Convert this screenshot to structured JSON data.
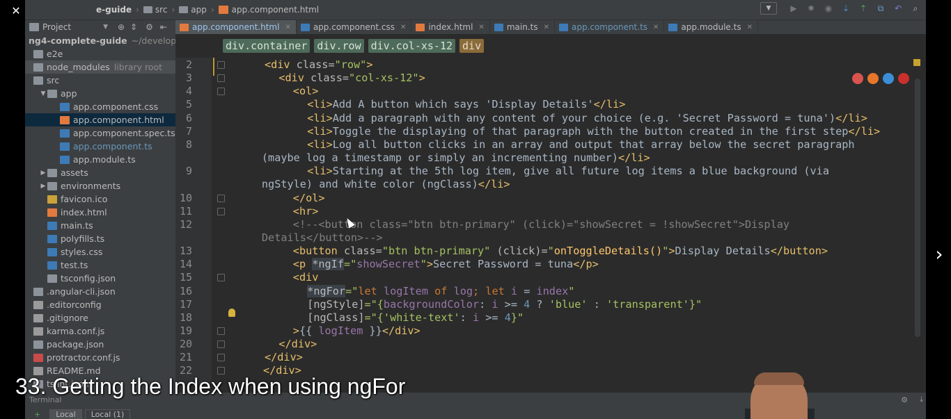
{
  "player": {
    "close_icon": "close-icon",
    "restore_icon": "restore-icon",
    "minimize_icon": "minimize-icon"
  },
  "navbar": {
    "crumbs": [
      "e-guide",
      "src",
      "app",
      "app.component.html"
    ]
  },
  "project_panel": {
    "label": "Project"
  },
  "tree": {
    "items": [
      {
        "label": "ng4-complete-guide",
        "extra": "~/developme",
        "type": "folder",
        "indent": 0
      },
      {
        "label": "e2e",
        "type": "folder",
        "indent": 0
      },
      {
        "label": "node_modules",
        "extra": "library root",
        "type": "folder",
        "indent": 0,
        "highlighted": true
      },
      {
        "label": "src",
        "type": "folder",
        "indent": 0
      },
      {
        "label": "app",
        "type": "folder",
        "indent": 1,
        "expanded": true
      },
      {
        "label": "app.component.css",
        "type": "css",
        "indent": 2
      },
      {
        "label": "app.component.html",
        "type": "html",
        "indent": 2,
        "selected": true
      },
      {
        "label": "app.component.spec.ts",
        "type": "ts",
        "indent": 2
      },
      {
        "label": "app.component.ts",
        "type": "ts",
        "indent": 2,
        "blue": true
      },
      {
        "label": "app.module.ts",
        "type": "ts",
        "indent": 2
      },
      {
        "label": "assets",
        "type": "folder",
        "indent": 1,
        "collapsed": true
      },
      {
        "label": "environments",
        "type": "folder",
        "indent": 1,
        "collapsed": true
      },
      {
        "label": "favicon.ico",
        "type": "ico",
        "indent": 1
      },
      {
        "label": "index.html",
        "type": "html",
        "indent": 1
      },
      {
        "label": "main.ts",
        "type": "ts",
        "indent": 1
      },
      {
        "label": "polyfills.ts",
        "type": "ts",
        "indent": 1
      },
      {
        "label": "styles.css",
        "type": "css",
        "indent": 1
      },
      {
        "label": "test.ts",
        "type": "ts",
        "indent": 1
      },
      {
        "label": "tsconfig.json",
        "type": "json",
        "indent": 1
      },
      {
        "label": ".angular-cli.json",
        "type": "json",
        "indent": 0
      },
      {
        "label": ".editorconfig",
        "type": "file",
        "indent": 0
      },
      {
        "label": ".gitignore",
        "type": "file",
        "indent": 0
      },
      {
        "label": "karma.conf.js",
        "type": "file",
        "indent": 0
      },
      {
        "label": "package.json",
        "type": "json",
        "indent": 0
      },
      {
        "label": "protractor.conf.js",
        "type": "red",
        "indent": 0
      },
      {
        "label": "README.md",
        "type": "file",
        "indent": 0
      },
      {
        "label": "tslint.json",
        "type": "json",
        "indent": 0
      }
    ]
  },
  "tabs": [
    {
      "label": "app.component.html",
      "icon": "html",
      "active": true
    },
    {
      "label": "app.component.css",
      "icon": "css"
    },
    {
      "label": "index.html",
      "icon": "html"
    },
    {
      "label": "main.ts",
      "icon": "ts"
    },
    {
      "label": "app.component.ts",
      "icon": "ts",
      "blue": true
    },
    {
      "label": "app.module.ts",
      "icon": "ts"
    }
  ],
  "breadcrumbs": [
    "div.container",
    "div.row",
    "div.col-xs-12",
    "div"
  ],
  "code_lines": [
    {
      "num": "2",
      "html": "<span class=\"t\">&lt;div</span> <span class=\"a\">class=</span><span class=\"s\">\"row\"</span><span class=\"t\">&gt;</span>",
      "indent": 0
    },
    {
      "num": "3",
      "html": "<span class=\"t\">&lt;div</span> <span class=\"a\">class=</span><span class=\"s\">\"col-xs-12\"</span><span class=\"t\">&gt;</span>",
      "indent": 1
    },
    {
      "num": "4",
      "html": "<span class=\"t\">&lt;ol&gt;</span>",
      "indent": 2
    },
    {
      "num": "5",
      "html": "<span class=\"t\">&lt;li&gt;</span>Add A button which says 'Display Details'<span class=\"t\">&lt;/li&gt;</span>",
      "indent": 3
    },
    {
      "num": "6",
      "html": "<span class=\"t\">&lt;li&gt;</span>Add a paragraph with any content of your choice (e.g. 'Secret Password = tuna')<span class=\"t\">&lt;/li&gt;</span>",
      "indent": 3
    },
    {
      "num": "7",
      "html": "<span class=\"t\">&lt;li&gt;</span>Toggle the displaying of that paragraph with the button created in the first step<span class=\"t\">&lt;/li&gt;</span>",
      "indent": 3
    },
    {
      "num": "8",
      "html": "<span class=\"t\">&lt;li&gt;</span>Log all button clicks in an array and output that array below the secret paragraph",
      "indent": 3
    },
    {
      "num": "",
      "html": "(maybe log a timestamp or simply an incrementing number)<span class=\"t\">&lt;/li&gt;</span>",
      "indent": -0.2
    },
    {
      "num": "9",
      "html": "<span class=\"t\">&lt;li&gt;</span>Starting at the 5th log item, give all future log items a blue background (via",
      "indent": 3
    },
    {
      "num": "",
      "html": "ngStyle) and white color (ngClass)<span class=\"t\">&lt;/li&gt;</span>",
      "indent": -0.2
    },
    {
      "num": "10",
      "html": "<span class=\"t\">&lt;/ol&gt;</span>",
      "indent": 2
    },
    {
      "num": "11",
      "html": "<span class=\"t\">&lt;hr&gt;</span>",
      "indent": 2
    },
    {
      "num": "12",
      "html": "<span class=\"c\">&lt;!--&lt;button class=\"btn btn-primary\" (click)=\"showSecret = !showSecret\"&gt;Display</span>",
      "indent": 2
    },
    {
      "num": "",
      "html": "<span class=\"c\">Details&lt;/button&gt;--&gt;</span>",
      "indent": -0.2
    },
    {
      "num": "13",
      "html": "<span class=\"t\">&lt;button</span> <span class=\"a\">class=</span><span class=\"s\">\"btn btn-primary\"</span> <span class=\"a\">(click)=</span><span class=\"s\">\"</span><span class=\"ang\">onToggleDetails()</span><span class=\"s\">\"</span><span class=\"t\">&gt;</span>Display Details<span class=\"t\">&lt;/button&gt;</span>",
      "indent": 2
    },
    {
      "num": "14",
      "html": "<span class=\"t\">&lt;p</span> <span class=\"a hlbg\">*ngIf</span><span class=\"s\">=\"</span><span class=\"ngx\">showSecret</span><span class=\"s\">\"</span><span class=\"t\">&gt;</span>Secret Password = tuna<span class=\"t\">&lt;/p&gt;</span>",
      "indent": 2
    },
    {
      "num": "15",
      "html": "<span class=\"t\">&lt;div</span>",
      "indent": 2
    },
    {
      "num": "16",
      "html": "<span class=\"a hlbg\">*ngFor</span><span class=\"s\">=\"</span><span class=\"m\">let</span> <span class=\"ngx\">logItem</span> <span class=\"m\">of</span> <span class=\"ngx\">log</span><span class=\"m\">;</span> <span class=\"m\">let</span> <span class=\"ngx\">i</span> = <span class=\"ngx\">index</span><span class=\"s\">\"</span>",
      "indent": 3
    },
    {
      "num": "17",
      "html": "<span class=\"a\">[ngStyle]</span><span class=\"s\">=\"{</span><span class=\"ngx\">backgroundColor</span>: <span class=\"ngx\">i</span> &gt;= <span class=\"n\">4</span> ? <span class=\"s\">'blue'</span> : <span class=\"s\">'transparent'</span><span class=\"s\">}\"</span>",
      "indent": 3
    },
    {
      "num": "18",
      "html": "<span class=\"a\">[ngClass]</span><span class=\"s\">=\"{</span><span class=\"s\">'white-text'</span>: <span class=\"ngx\">i</span> &gt;= <span class=\"n\">4</span><span class=\"s\">}\"</span>",
      "indent": 3
    },
    {
      "num": "19",
      "html": "<span class=\"t\">&gt;</span>{{ <span class=\"ngx\">logItem</span> }}<span class=\"t\">&lt;/div&gt;</span>",
      "indent": 2
    },
    {
      "num": "20",
      "html": "<span class=\"t\">&lt;/div&gt;</span>",
      "indent": 1
    },
    {
      "num": "21",
      "html": "<span class=\"t\">&lt;/div&gt;</span>",
      "indent": 0
    },
    {
      "num": "22",
      "html": "<span class=\"t\">&lt;/div&gt;</span>",
      "indent": -0.1
    }
  ],
  "terminal": {
    "title": "Terminal",
    "tabs": [
      "Local",
      "Local (1)"
    ]
  },
  "video": {
    "subtitle": "33. Getting the Index when using ngFor",
    "next_icon": "chevron-right-icon"
  },
  "colors": {
    "ide_bg": "#2b2b2b",
    "panel_bg": "#3c3f41",
    "tag": "#e8bf6a",
    "string": "#a5c261",
    "selection": "#0d293e"
  }
}
